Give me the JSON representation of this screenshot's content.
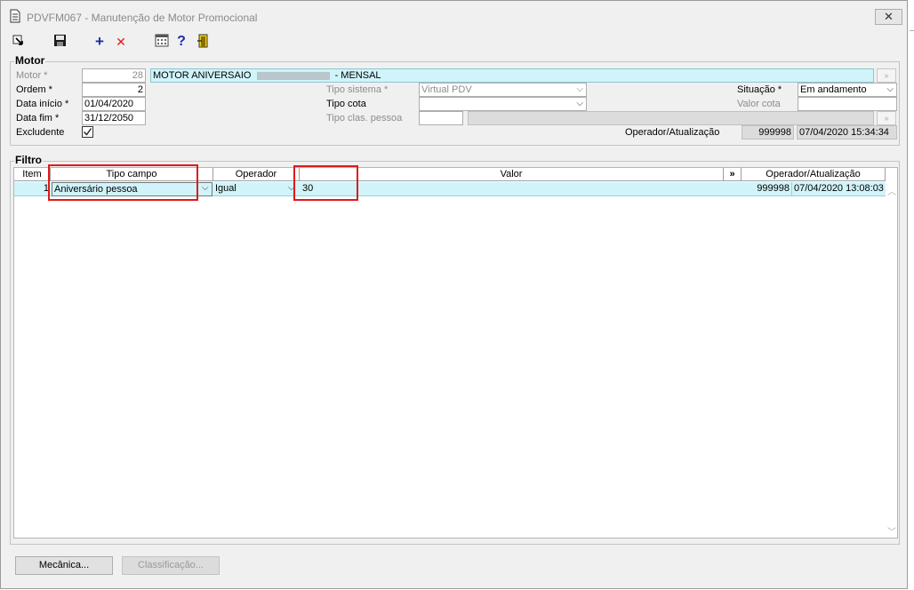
{
  "window": {
    "title": "PDVFM067 - Manutenção de Motor Promocional",
    "close_symbol": "✕"
  },
  "toolbar": {
    "add_symbol": "+",
    "delete_symbol": "✕",
    "help_symbol": "?"
  },
  "motor": {
    "group_title": "Motor",
    "motor_label": "Motor *",
    "motor_number": "28",
    "motor_name_prefix": "MOTOR ANIVERSAIO",
    "motor_name_suffix": "- MENSAL",
    "ordem_label": "Ordem *",
    "ordem_value": "2",
    "data_inicio_label": "Data início *",
    "data_inicio_value": "01/04/2020",
    "data_fim_label": "Data fim *",
    "data_fim_value": "31/12/2050",
    "excludente_label": "Excludente",
    "excludente_checked": true,
    "tipo_sistema_label": "Tipo sistema *",
    "tipo_sistema_value": "Virtual PDV",
    "tipo_cota_label": "Tipo cota",
    "tipo_cota_value": "",
    "tipo_clas_label": "Tipo clas. pessoa",
    "situacao_label": "Situação *",
    "situacao_value": "Em andamento",
    "valor_cota_label": "Valor cota",
    "valor_cota_value": "",
    "operador_label": "Operador/Atualização",
    "operador_value": "999998",
    "atualizacao_value": "07/04/2020 15:34:34"
  },
  "filtro": {
    "group_title": "Filtro",
    "columns": {
      "item": "Item",
      "tipo_campo": "Tipo campo",
      "operador": "Operador",
      "valor": "Valor",
      "expand": "»",
      "operador_atualizacao": "Operador/Atualização"
    },
    "rows": [
      {
        "item": "1",
        "tipo_campo": "Aniversário pessoa",
        "operador": "Igual",
        "valor": "30",
        "operador_id": "999998",
        "atualizacao": "07/04/2020 13:08:03"
      }
    ]
  },
  "buttons": {
    "mecanica": "Mecânica...",
    "classificacao": "Classificação..."
  }
}
